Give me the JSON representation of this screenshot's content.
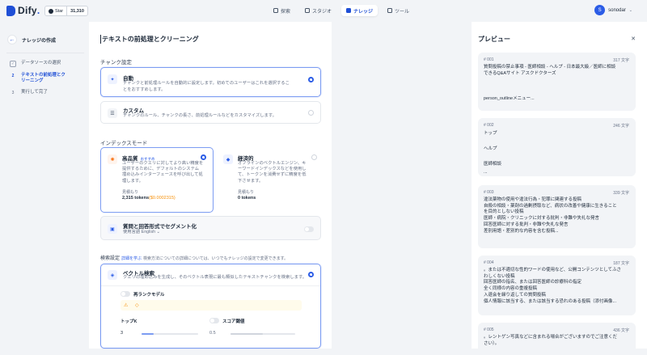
{
  "header": {
    "logo": "Dify",
    "logo_suffix": ".",
    "github_star_label": "Star",
    "github_star_count": "31,310",
    "nav": [
      {
        "label": "探索",
        "icon": "compass-icon"
      },
      {
        "label": "スタジオ",
        "icon": "studio-icon"
      },
      {
        "label": "ナレッジ",
        "icon": "knowledge-icon",
        "active": true
      },
      {
        "label": "ツール",
        "icon": "tools-icon"
      }
    ],
    "user_initial": "S",
    "user_name": "sonodar"
  },
  "sidebar": {
    "title": "ナレッジの作成",
    "steps": [
      {
        "num": "✓",
        "label": "データソースの選択",
        "state": "done"
      },
      {
        "num": "2",
        "label": "テキストの前処理とクリーニング",
        "state": "current"
      },
      {
        "num": "3",
        "label": "実行して完了",
        "state": "pending"
      }
    ]
  },
  "main": {
    "title": "テキストの前処理とクリーニング",
    "chunk_section": "チャンク設定",
    "auto": {
      "title": "自動",
      "desc1": "チャンクと前処理ルールを自動的に設定します。初めてのユーザーはこれを選択するこ",
      "desc2": "とをおすすめします。"
    },
    "custom": {
      "title": "カスタム",
      "desc": "チャンクのルール、チャンクの長さ、前処理ルールなどをカスタマイズします。"
    },
    "index_section": "インデックスモード",
    "high": {
      "title": "高品質",
      "badge": "おすすめ",
      "desc": "ユーザーのクエリに対してより高い精度を\n提供するために、デフォルトのシステム\n埋め込みインターフェースを呼び出して処\n理します。",
      "est_label": "見積もり",
      "tokens": "2,315 tokens",
      "price": "($0.0002315)"
    },
    "economy": {
      "title": "経済的",
      "desc": "オフラインのベクトルエンジン、キ\nーワードインデックスなどを使用し\nて、トークンを消費せずに精度を低\n下させます。",
      "est_label": "見積もり",
      "tokens": "0 tokens"
    },
    "qa": {
      "title": "質問と回答形式でセグメント化",
      "lang": "使用言語 English ⌄"
    },
    "search_section": "検索設定",
    "search_link": "詳細を学ぶ",
    "search_note": "検索方法についての詳細については、いつでもナレッジの設定で変更できます。",
    "vector": {
      "title": "ベクトル検索",
      "desc": "クエリの埋め込みを生成し、そのベクトル表現に最も類似したテキストチャンクを検索します。",
      "rerank_label": "再ランクモデル",
      "topk_label": "トップK",
      "topk_value": "3",
      "score_label": "スコア閾値",
      "score_value": "0.5"
    }
  },
  "preview": {
    "title": "プレビュー",
    "chunks": [
      {
        "id": "# 001",
        "count": "317 文字",
        "body": "質問投稿の禁止事項 - 医師相談 - ヘルプ - 日本最大級／医師に相談\nできるQ&Aサイト アスクドクターズ\n\n\n\nperson_outlineメニュー..."
      },
      {
        "id": "# 002",
        "count": "246 文字",
        "body": "トップ\n\nヘルプ\n\n医師相談\n..."
      },
      {
        "id": "# 003",
        "count": "339 文字",
        "body": "違法薬物の使用や違法行為・犯罪に関連する投稿\n自殺の相談・薬剤の過剰摂取など、病状の改善や健康に生きること\nを目的としない投稿\n医師・病院・クリニックに対する批判・非難や失礼な発言\n回答医師に対する批判・非難や失礼な発言\n差別用語・差別的な内容を含む投稿..."
      },
      {
        "id": "# 004",
        "count": "187 文字",
        "body": "。または不適切な性的ワードの使用など、公開コンテンツとしてふさ\nわしくない投稿\n回答医師の指名、または回答医師の診療科の指定\n全く同様の内容の重複投稿\n入退会を繰り返しての質問投稿\n個人情報に該当する、または該当する恐れのある投稿（添付画像..."
      },
      {
        "id": "# 005",
        "count": "436 文字",
        "body": "。レントゲン写真などに含まれる場合がございますのでご注意くだ\nさい）。"
      }
    ]
  }
}
